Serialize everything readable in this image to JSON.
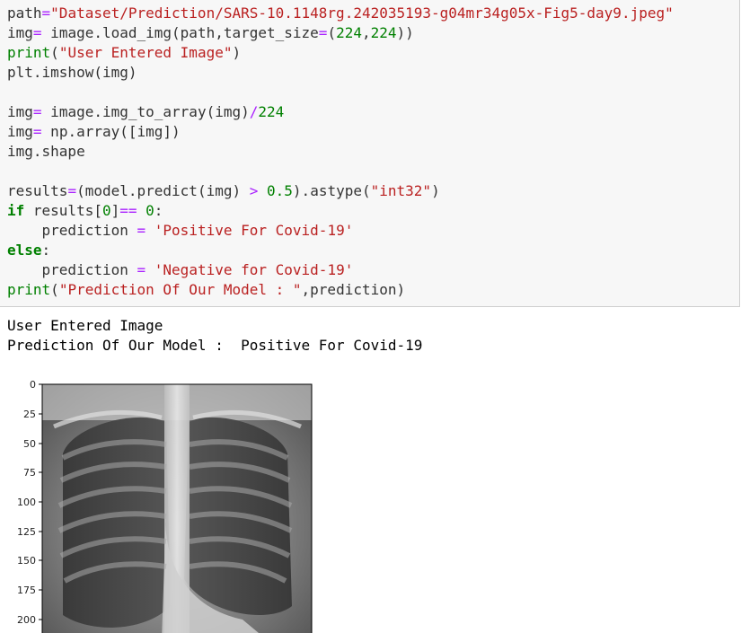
{
  "code": {
    "line1": {
      "var": "path",
      "eq": "=",
      "str": "\"Dataset/Prediction/SARS-10.1148rg.242035193-g04mr34g05x-Fig5-day9.jpeg\""
    },
    "line2": {
      "a": "img",
      "eq": "=",
      "b": " image.load_img(path,target_size",
      "eq2": "=",
      "c": "(",
      "n1": "224",
      "comma": ",",
      "n2": "224",
      "d": "))"
    },
    "line3": {
      "fn": "print",
      "a": "(",
      "str": "\"User Entered Image\"",
      "b": ")"
    },
    "line4": {
      "text": "plt.imshow(img)"
    },
    "line6": {
      "a": "img",
      "eq": "=",
      "b": " image.img_to_array(img)",
      "op": "/",
      "num": "224"
    },
    "line7": {
      "a": "img",
      "eq": "=",
      "b": " np.array([img])"
    },
    "line8": {
      "text": "img.shape"
    },
    "line10": {
      "a": "results",
      "eq": "=",
      "b": "(model.predict(img) ",
      "op": ">",
      "sp": " ",
      "num": "0.5",
      "c": ").astype(",
      "str": "\"int32\"",
      "d": ")"
    },
    "line11": {
      "kw": "if",
      "a": " results[",
      "num0": "0",
      "b": "]",
      "op": "==",
      "sp": " ",
      "num": "0",
      "c": ":"
    },
    "line12": {
      "indent": "    ",
      "a": "prediction ",
      "eq": "=",
      "sp": " ",
      "str": "'Positive For Covid-19'"
    },
    "line13": {
      "kw": "else",
      "c": ":"
    },
    "line14": {
      "indent": "    ",
      "a": "prediction ",
      "eq": "=",
      "sp": " ",
      "str": "'Negative for Covid-19'"
    },
    "line15": {
      "fn": "print",
      "a": "(",
      "str": "\"Prediction Of Our Model : \"",
      "b": ",prediction)"
    }
  },
  "output": {
    "line1": "User Entered Image",
    "line2": "Prediction Of Our Model :  Positive For Covid-19"
  },
  "plot": {
    "y_ticks": [
      "0",
      "25",
      "50",
      "75",
      "100",
      "125",
      "150",
      "175",
      "200"
    ]
  }
}
